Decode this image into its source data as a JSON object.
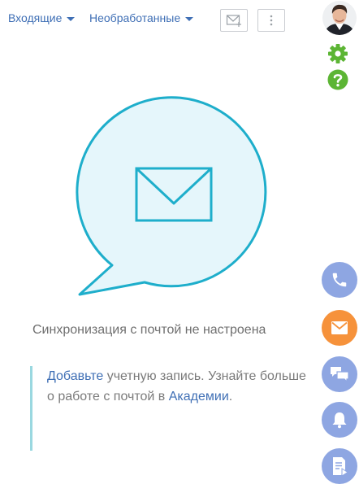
{
  "header": {
    "folder_dropdown": "Входящие",
    "filter_dropdown": "Необработанные",
    "new_email_icon": "envelope-plus-icon",
    "more_icon": "vertical-dots-icon"
  },
  "sidebar": {
    "settings_icon": "gear-icon",
    "help_icon": "question-icon"
  },
  "main": {
    "empty_message": "Синхронизация с почтой не настроена",
    "hint": {
      "add_link": "Добавьте",
      "text_part1": " учетную запись. Узнайте больше о работе с почтой в ",
      "academy_link": "Академии",
      "text_end": "."
    }
  },
  "communication_panel": [
    {
      "name": "phone-icon",
      "color": "#8ea6e2"
    },
    {
      "name": "email-icon",
      "color": "#f6923b"
    },
    {
      "name": "chat-icon",
      "color": "#8ea6e2"
    },
    {
      "name": "bell-icon",
      "color": "#8ea6e2"
    },
    {
      "name": "feed-icon",
      "color": "#8ea6e2"
    }
  ],
  "colors": {
    "link": "#3f6fb5",
    "bubble_stroke": "#1eaecb",
    "bubble_fill": "#e5f6fb",
    "settings_green": "#5cb534",
    "accent_orange": "#f6923b",
    "panel_blue": "#8ea6e2"
  }
}
